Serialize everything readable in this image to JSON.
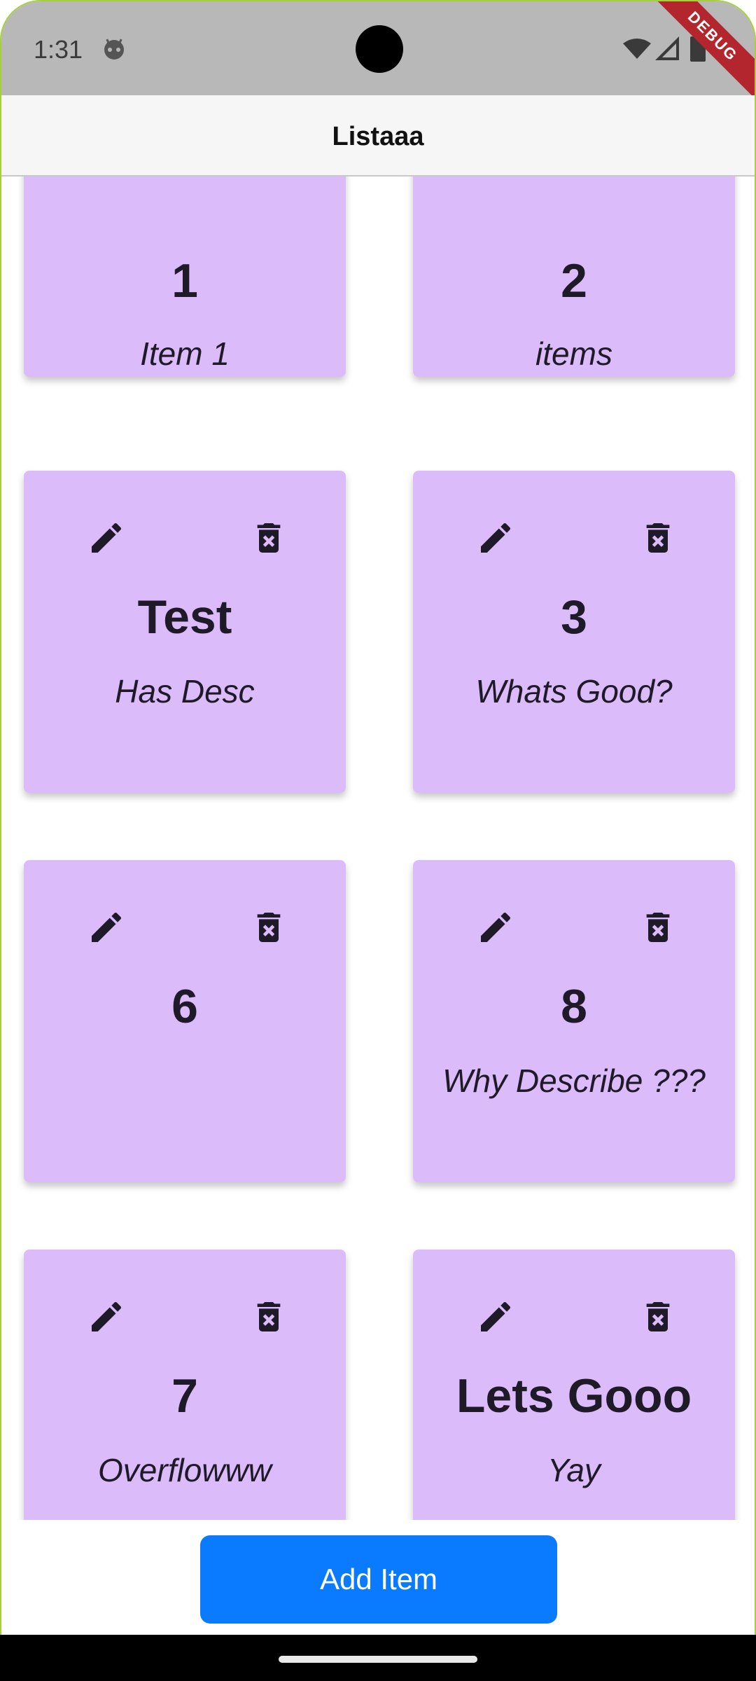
{
  "status_bar": {
    "time": "1:31",
    "debug_label": "DEBUG"
  },
  "app_bar": {
    "title": "Listaaa"
  },
  "cards": [
    {
      "title": "1",
      "description": "Item 1",
      "has_actions": false
    },
    {
      "title": "2",
      "description": "items",
      "has_actions": false
    },
    {
      "title": "Test",
      "description": "Has Desc",
      "has_actions": true
    },
    {
      "title": "3",
      "description": "Whats Good?",
      "has_actions": true
    },
    {
      "title": "6",
      "description": "",
      "has_actions": true
    },
    {
      "title": "8",
      "description": "Why Describe ???",
      "has_actions": true
    },
    {
      "title": "7",
      "description": "Overflowww",
      "has_actions": true
    },
    {
      "title": "Lets Gooo",
      "description": "Yay",
      "has_actions": true
    }
  ],
  "add_button": {
    "label": "Add Item"
  },
  "colors": {
    "card": "#dcbbfb",
    "button": "#0a7bff",
    "debug_banner": "#b3262e"
  },
  "icons": {
    "edit": "pencil-icon",
    "delete": "trash-x-icon"
  }
}
